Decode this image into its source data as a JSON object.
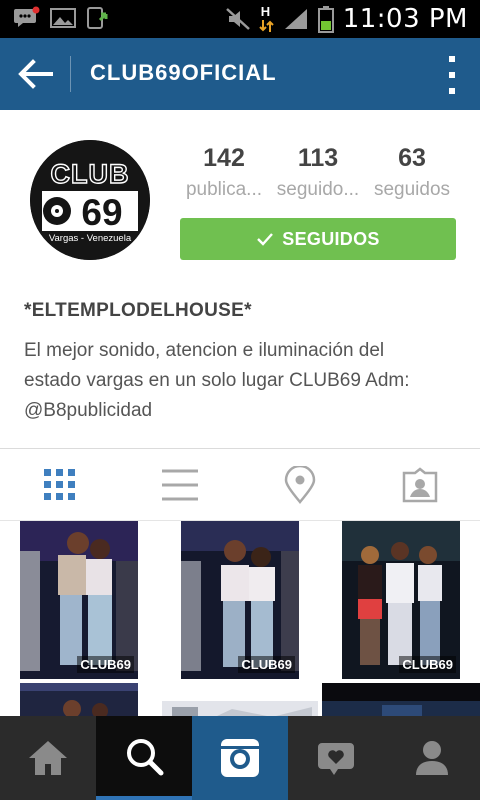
{
  "status_bar": {
    "time": "11:03 PM",
    "network_type": "H",
    "icons": [
      "chat-notification-icon",
      "image-icon",
      "download-icon",
      "mute-icon",
      "signal-icon",
      "battery-icon"
    ]
  },
  "app_bar": {
    "title": "CLUB69OFICIAL",
    "back_icon": "arrow-left-icon",
    "menu_icon": "more-vertical-icon"
  },
  "profile": {
    "avatar_text": "CLUB",
    "avatar_number": "69",
    "avatar_subtitle": "Vargas - Venezuela",
    "stats": [
      {
        "number": "142",
        "label": "publica..."
      },
      {
        "number": "113",
        "label": "seguido..."
      },
      {
        "number": "63",
        "label": "seguidos"
      }
    ],
    "follow_button_label": "SEGUIDOS",
    "name": "*ELTEMPLODELHOUSE*",
    "bio": "El mejor sonido, atencion e iluminación del estado vargas en un solo lugar CLUB69 Adm: @B8publicidad"
  },
  "tabs": [
    {
      "icon": "grid-icon",
      "active": true
    },
    {
      "icon": "list-icon",
      "active": false
    },
    {
      "icon": "location-pin-icon",
      "active": false
    },
    {
      "icon": "tagged-user-icon",
      "active": false
    }
  ],
  "photos": [
    {
      "watermark": "CLUB69"
    },
    {
      "watermark": "CLUB69"
    },
    {
      "watermark": "CLUB69"
    },
    {
      "watermark": ""
    },
    {
      "watermark": ""
    },
    {
      "watermark": ""
    }
  ],
  "bottom_nav": [
    {
      "icon": "home-icon",
      "active": false
    },
    {
      "icon": "search-icon",
      "active": true
    },
    {
      "icon": "camera-icon",
      "active": false
    },
    {
      "icon": "activity-heart-icon",
      "active": false
    },
    {
      "icon": "profile-icon",
      "active": false
    }
  ],
  "colors": {
    "app_bar": "#1f5b8c",
    "follow_button": "#70c050",
    "active_tab": "#3f7fbf",
    "bottom_nav": "#2b2b2b",
    "camera_button": "#1f5b8c"
  }
}
